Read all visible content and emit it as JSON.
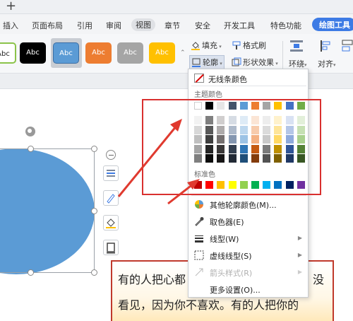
{
  "menubar": {
    "items": [
      "插入",
      "页面布局",
      "引用",
      "审阅",
      "视图",
      "章节",
      "安全",
      "开发工具",
      "特色功能"
    ],
    "active_item": "视图",
    "drawing_tools": "绘图工具"
  },
  "ribbon": {
    "styles": [
      {
        "label": "Abc",
        "bg": "#ffffff",
        "fg": "#222222",
        "border": "#8bc34a"
      },
      {
        "label": "Abc",
        "bg": "#000000",
        "fg": "#ffffff"
      },
      {
        "label": "Abc",
        "bg": "#5b9bd5",
        "fg": "#ffffff",
        "selected": true
      },
      {
        "label": "Abc",
        "bg": "#ed7d31",
        "fg": "#ffffff"
      },
      {
        "label": "Abc",
        "bg": "#a5a5a5",
        "fg": "#ffffff"
      },
      {
        "label": "Abc",
        "bg": "#ffc000",
        "fg": "#ffffff"
      }
    ],
    "fill": "填充",
    "outline": "轮廓",
    "format_brush": "格式刷",
    "shape_effects": "形状效果",
    "wrap": "环绕",
    "align": "对齐"
  },
  "dropdown": {
    "no_line_color": "无线条颜色",
    "theme_colors_label": "主题颜色",
    "theme_top_row": [
      "#ffffff",
      "#000000",
      "#e7e6e6",
      "#44546a",
      "#5b9bd5",
      "#ed7d31",
      "#a5a5a5",
      "#ffc000",
      "#4472c4",
      "#70ad47"
    ],
    "theme_shades": [
      [
        "#f2f2f2",
        "#7f7f7f",
        "#d0cece",
        "#d6dce4",
        "#deebf6",
        "#fbe5d5",
        "#ededed",
        "#fff2cc",
        "#d9e2f3",
        "#e2efd9"
      ],
      [
        "#d8d8d8",
        "#595959",
        "#aeabab",
        "#adb9ca",
        "#bdd7ee",
        "#f7cbac",
        "#dbdbdb",
        "#fee599",
        "#b4c6e7",
        "#c5e0b3"
      ],
      [
        "#bfbfbf",
        "#3f3f3f",
        "#757070",
        "#8496b0",
        "#9cc3e5",
        "#f4b183",
        "#c9c9c9",
        "#ffd965",
        "#8eaadb",
        "#a8d08d"
      ],
      [
        "#a5a5a5",
        "#262626",
        "#3a3838",
        "#333f4f",
        "#2e75b5",
        "#c55a11",
        "#7b7b7b",
        "#bf9000",
        "#2f5496",
        "#538135"
      ],
      [
        "#7f7f7f",
        "#0c0c0c",
        "#171616",
        "#222a35",
        "#1e4e79",
        "#833c0b",
        "#525252",
        "#7f6000",
        "#1f3864",
        "#375623"
      ]
    ],
    "standard_colors_label": "标准色",
    "standard_colors": [
      "#c00000",
      "#ff0000",
      "#ffc000",
      "#ffff00",
      "#92d050",
      "#00b050",
      "#00b0f0",
      "#0070c0",
      "#002060",
      "#7030a0"
    ],
    "more_colors": "其他轮廓颜色(M)...",
    "eyedropper": "取色器(E)",
    "line_type": "线型(W)",
    "dash_type": "虚线线型(S)",
    "arrow_style": "箭头样式(R)",
    "more_settings": "更多设置(O)..."
  },
  "document": {
    "line1": "有的人把心都",
    "line1_tail": "没",
    "line2": "看见，因为你不喜欢。有的人把你的"
  },
  "colors": {
    "accent": "#3d7be5",
    "annotation_red": "#d9302f",
    "shape_fill": "#5b9bd5"
  }
}
